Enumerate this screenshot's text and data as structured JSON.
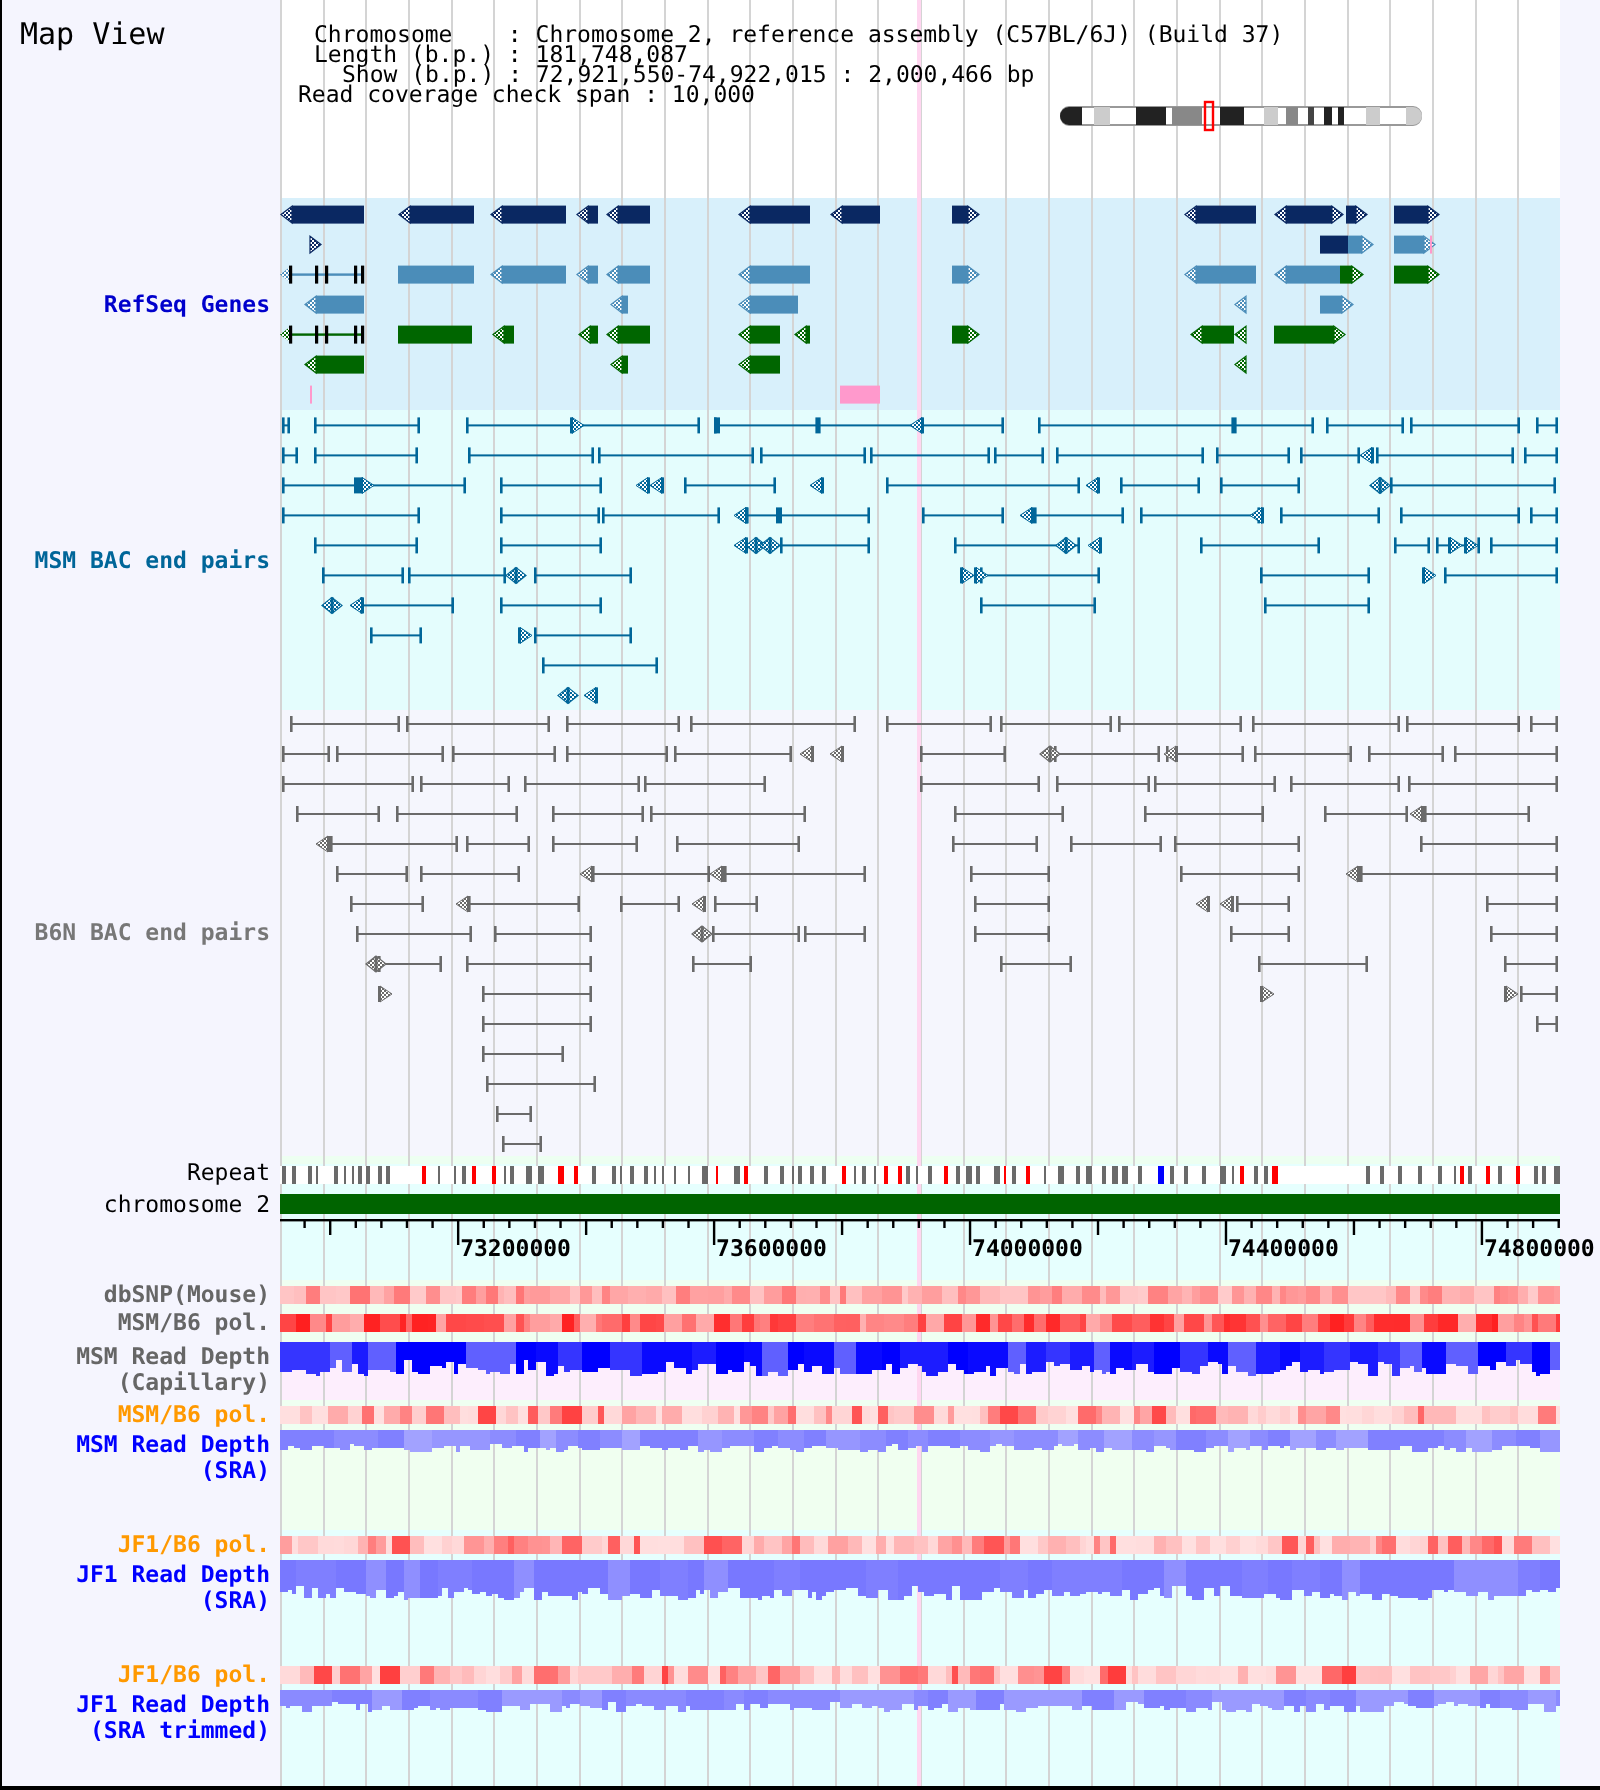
{
  "title": "Map View",
  "info_lines": [
    "Chromosome    : Chromosome 2, reference assembly (C57BL/6J) (Build 37)",
    "Length (b.p.) : 181,748,087",
    "Show (b.p.) : 72,921,550-74,922,015 : 2,000,466 bp",
    "Read coverage check span : 10,000"
  ],
  "tracks": [
    {
      "kind": "genes",
      "label": "RefSeq Genes",
      "color": "#0000cc"
    },
    {
      "kind": "bac",
      "label": "MSM BAC end pairs",
      "color": "#006699"
    },
    {
      "kind": "bac",
      "label": "B6N BAC end pairs",
      "color": "#777777"
    },
    {
      "kind": "repeat",
      "label": "Repeat",
      "color": "#000000"
    },
    {
      "kind": "chromosome",
      "label": "chromosome 2",
      "color": "#000000"
    },
    {
      "kind": "axis",
      "ticks": [
        "73200000",
        "73600000",
        "74000000",
        "74400000",
        "74800000"
      ]
    },
    {
      "kind": "heatmap",
      "label": "dbSNP(Mouse)",
      "color": "#666666"
    },
    {
      "kind": "heatmap",
      "label": "MSM/B6 pol.",
      "color": "#666666"
    },
    {
      "kind": "depth",
      "label": "MSM Read Depth (Capillary)",
      "color": "#666666"
    },
    {
      "kind": "heatmap",
      "label": "MSM/B6 pol.",
      "color": "#ff9900"
    },
    {
      "kind": "depth",
      "label": "MSM Read Depth (SRA)",
      "color": "#0000ff"
    },
    {
      "kind": "heatmap",
      "label": "JF1/B6 pol.",
      "color": "#ff9900"
    },
    {
      "kind": "depth",
      "label": "JF1 Read Depth (SRA)",
      "color": "#0000ff"
    },
    {
      "kind": "heatmap",
      "label": "JF1/B6 pol.",
      "color": "#ff9900"
    },
    {
      "kind": "depth",
      "label": "JF1 Read Depth (SRA trimmed)",
      "color": "#0000ff"
    }
  ]
}
